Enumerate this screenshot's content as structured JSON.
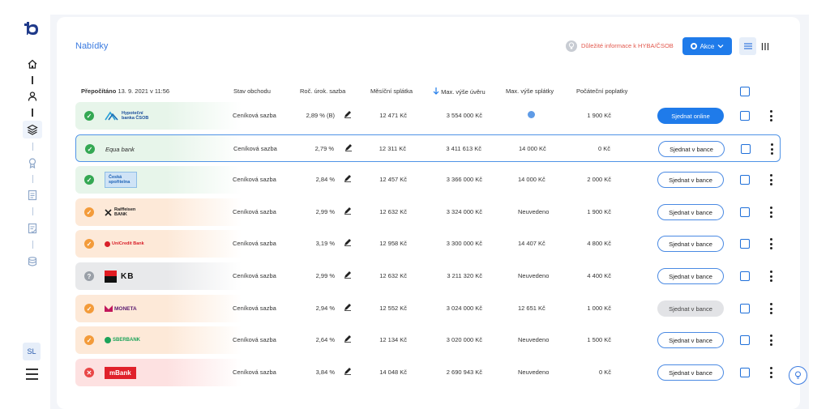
{
  "sidebar": {
    "user_initials": "SL",
    "icons": [
      "logo-icon",
      "home-icon",
      "user-icon",
      "layers-icon",
      "award-icon",
      "document-icon",
      "checklist-icon",
      "database-icon",
      "menu-icon"
    ]
  },
  "header": {
    "title": "Nabídky",
    "info_link": "Důležité informace k HYBA/ČSOB",
    "akce_label": "Akce"
  },
  "table": {
    "recalc_label": "Přepočítáno",
    "recalc_date": "13. 9. 2021 v 11:56",
    "columns": [
      "Stav obchodu",
      "Roč. úrok. sazba",
      "Měsíční splátka",
      "Max. výše úvěru",
      "Max. výše splátky",
      "Počáteční poplatky"
    ],
    "rows": [
      {
        "bank": "Hypoteční banka ČSOB",
        "status": "ok",
        "stav": "Ceníková sazba",
        "rate": "2,89 % (B)",
        "monthly": "12 471 Kč",
        "max_loan": "3 554 000 Kč",
        "max_payment": "",
        "fees": "1 900 Kč",
        "action": "Sjednat online",
        "action_style": "online",
        "selected": false
      },
      {
        "bank": "Equa bank",
        "status": "ok",
        "stav": "Ceníková sazba",
        "rate": "2,79 %",
        "monthly": "12 311 Kč",
        "max_loan": "3 411 613 Kč",
        "max_payment": "14 000 Kč",
        "fees": "0 Kč",
        "action": "Sjednat v bance",
        "action_style": "outline",
        "selected": true
      },
      {
        "bank": "Česká spořitelna",
        "status": "ok",
        "stav": "Ceníková sazba",
        "rate": "2,84 %",
        "monthly": "12 457 Kč",
        "max_loan": "3 366 000 Kč",
        "max_payment": "14 000 Kč",
        "fees": "2 000 Kč",
        "action": "Sjednat v bance",
        "action_style": "outline",
        "selected": false
      },
      {
        "bank": "Raiffeisen BANK",
        "status": "warn",
        "stav": "Ceníková sazba",
        "rate": "2,99 %",
        "monthly": "12 632 Kč",
        "max_loan": "3 324 000 Kč",
        "max_payment": "Neuvedeno",
        "fees": "1 900 Kč",
        "action": "Sjednat v bance",
        "action_style": "outline",
        "selected": false
      },
      {
        "bank": "UniCredit Bank",
        "status": "warn",
        "stav": "Ceníková sazba",
        "rate": "3,19 %",
        "monthly": "12 958 Kč",
        "max_loan": "3 300 000 Kč",
        "max_payment": "14 407 Kč",
        "fees": "4 800 Kč",
        "action": "Sjednat v bance",
        "action_style": "outline",
        "selected": false
      },
      {
        "bank": "KB",
        "status": "unknown",
        "stav": "Ceníková sazba",
        "rate": "2,99 %",
        "monthly": "12 632 Kč",
        "max_loan": "3 211 320 Kč",
        "max_payment": "Neuvedeno",
        "fees": "4 400 Kč",
        "action": "Sjednat v bance",
        "action_style": "outline",
        "selected": false
      },
      {
        "bank": "MONETA",
        "status": "warn",
        "stav": "Ceníková sazba",
        "rate": "2,94 %",
        "monthly": "12 552 Kč",
        "max_loan": "3 024 000 Kč",
        "max_payment": "12 651 Kč",
        "fees": "1 000 Kč",
        "action": "Sjednat v bance",
        "action_style": "disabled",
        "selected": false
      },
      {
        "bank": "SBERBANK",
        "status": "warn",
        "stav": "Ceníková sazba",
        "rate": "2,64 %",
        "monthly": "12 134 Kč",
        "max_loan": "3 020 000 Kč",
        "max_payment": "Neuvedeno",
        "fees": "1 500 Kč",
        "action": "Sjednat v bance",
        "action_style": "outline",
        "selected": false
      },
      {
        "bank": "mBank",
        "status": "error",
        "stav": "Ceníková sazba",
        "rate": "3,84 %",
        "monthly": "14 048 Kč",
        "max_loan": "2 690 943 Kč",
        "max_payment": "Neuvedeno",
        "fees": "0 Kč",
        "action": "Sjednat v bance",
        "action_style": "outline",
        "selected": false
      }
    ]
  },
  "colors": {
    "accent": "#1f7bea",
    "status_ok": "#34a853",
    "status_warn": "#f39b3a",
    "status_unknown": "#9aa0a8",
    "status_error": "#e94747",
    "row_ok_bg": "#e7f5ea",
    "row_warn_bg": "#fde9d8",
    "row_unknown_bg": "#e8e9eb",
    "row_error_bg": "#fde1e1"
  }
}
